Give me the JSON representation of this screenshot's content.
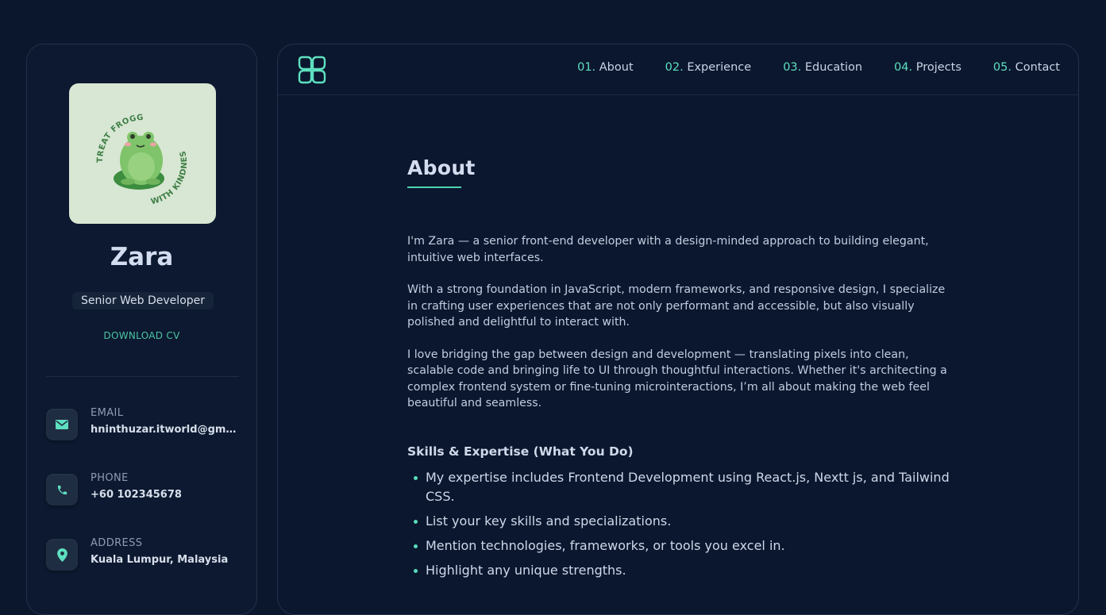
{
  "profile": {
    "name": "Zara",
    "role": "Senior Web Developer",
    "download_label": "DOWNLOAD CV",
    "avatar_text_top": "TREAT FROGGIES",
    "avatar_text_bottom": "WITH KINDNESS"
  },
  "contacts": [
    {
      "label": "EMAIL",
      "value": "hninthuzar.itworld@gmail.com",
      "icon": "mail-icon"
    },
    {
      "label": "PHONE",
      "value": "+60 102345678",
      "icon": "phone-icon"
    },
    {
      "label": "ADDRESS",
      "value": "Kuala Lumpur, Malaysia",
      "icon": "location-pin-icon"
    }
  ],
  "nav": [
    {
      "num": "01.",
      "label": "About"
    },
    {
      "num": "02.",
      "label": "Experience"
    },
    {
      "num": "03.",
      "label": "Education"
    },
    {
      "num": "04.",
      "label": "Projects"
    },
    {
      "num": "05.",
      "label": "Contact"
    }
  ],
  "about": {
    "heading": "About",
    "paragraphs": [
      "I'm Zara — a senior front-end developer with a design-minded approach to building elegant, intuitive web interfaces.",
      "With a strong foundation in JavaScript, modern frameworks, and responsive design, I specialize in crafting user experiences that are not only performant and accessible, but also visually polished and delightful to interact with.",
      "I love bridging the gap between design and development — translating pixels into clean, scalable code and bringing life to UI through thoughtful interactions. Whether it's architecting a complex frontend system or fine-tuning microinteractions, I’m all about making the web feel beautiful and seamless."
    ],
    "skills_heading": "Skills & Expertise (What You Do)",
    "skills": [
      "My expertise includes Frontend Development using React.js, Nextt js, and Tailwind CSS.",
      "List your key skills and specializations.",
      "Mention technologies, frameworks, or tools you excel in.",
      "Highlight any unique strengths."
    ]
  },
  "colors": {
    "background": "#0b172d",
    "accent": "#5ee0c0",
    "avatar_bg": "#d7e7d3"
  }
}
